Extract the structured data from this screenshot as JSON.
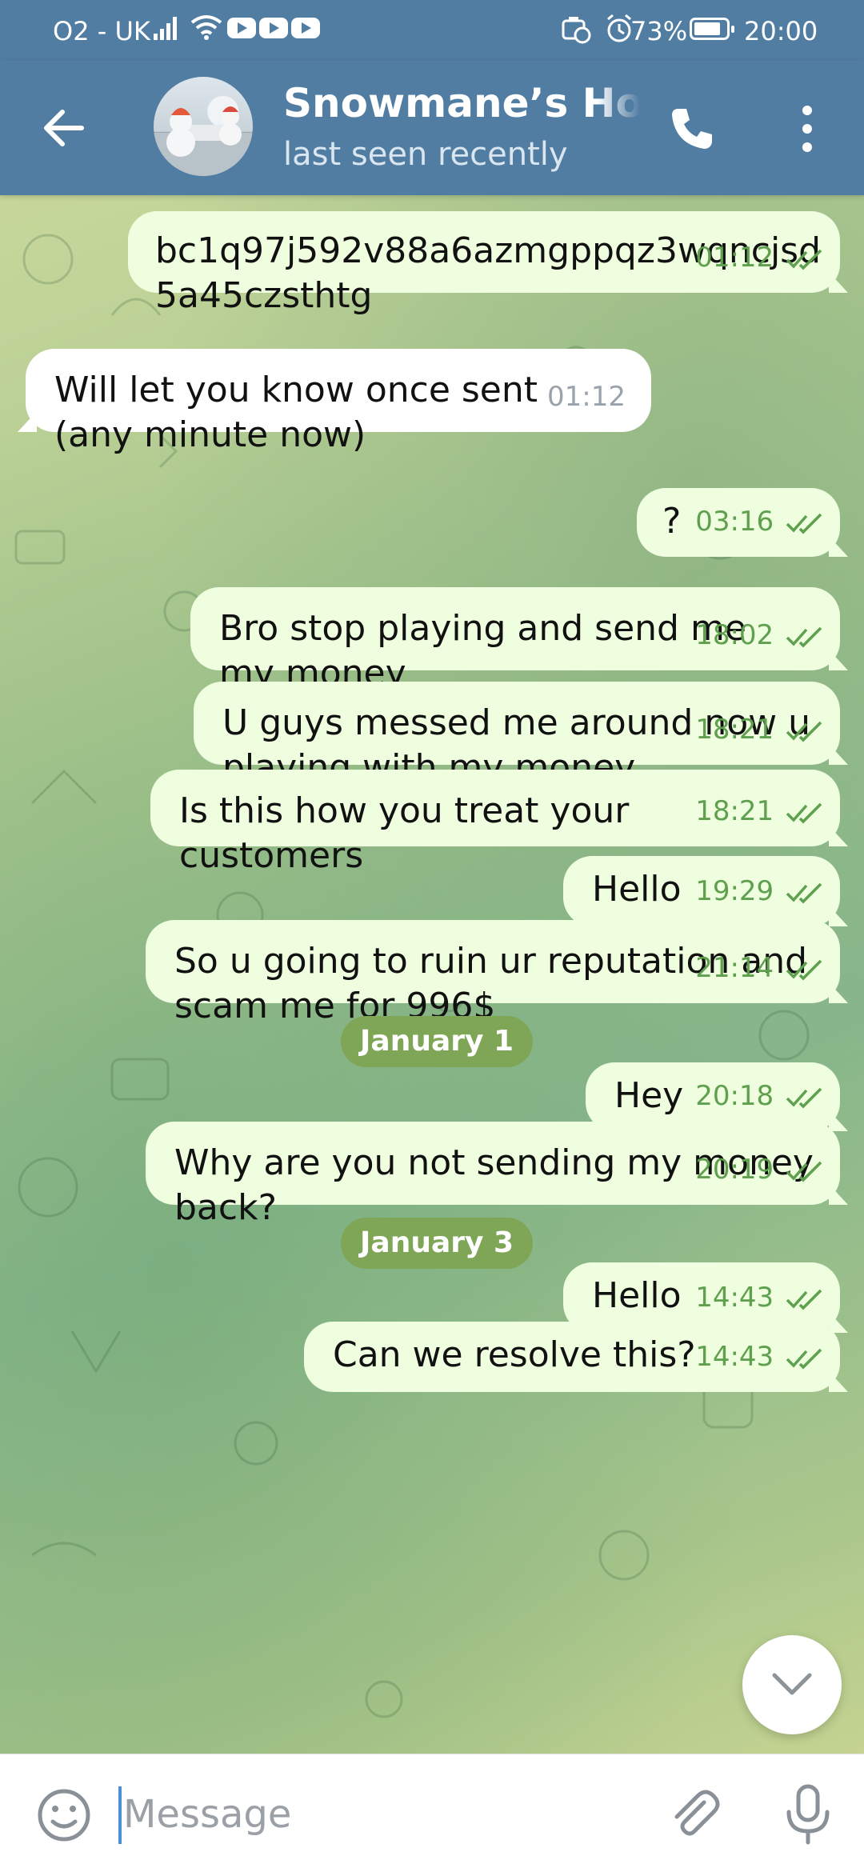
{
  "status_bar": {
    "carrier": "O2 - UK",
    "battery": "73%",
    "time": "20:00",
    "icons": [
      "signal-icon",
      "wifi-icon",
      "youtube-icon",
      "youtube-icon",
      "youtube-icon",
      "battery-saver-icon",
      "alarm-icon",
      "battery-icon"
    ]
  },
  "header": {
    "title": "Snowmane’s Home",
    "subtitle": "last seen recently",
    "back_icon": "arrow-left-icon",
    "call_icon": "phone-icon",
    "menu_icon": "more-vertical-icon"
  },
  "messages": [
    {
      "text": "bc1q97j592v88a6azmgppqz3wqncjsd 5a45czsthtg",
      "time": "01:12",
      "direction": "outgoing",
      "read": true
    },
    {
      "text": "Will let you know once sent (any minute now)",
      "time": "01:12",
      "direction": "incoming"
    },
    {
      "text": "?",
      "time": "03:16",
      "direction": "outgoing",
      "read": true
    },
    {
      "text": "Bro stop playing and send me my money",
      "time": "18:02",
      "direction": "outgoing",
      "read": true
    },
    {
      "text": "U guys messed me around now u playing with my money",
      "time": "18:21",
      "direction": "outgoing",
      "read": true
    },
    {
      "text": "Is this how you treat your customers",
      "time": "18:21",
      "direction": "outgoing",
      "read": true
    },
    {
      "text": "Hello",
      "time": "19:29",
      "direction": "outgoing",
      "read": true
    },
    {
      "text": "So u going to ruin ur reputation and scam me for 996$",
      "time": "21:14",
      "direction": "outgoing",
      "read": true
    },
    {
      "text": "Hey",
      "time": "20:18",
      "direction": "outgoing",
      "read": true
    },
    {
      "text": "Why are you not sending my money back?",
      "time": "20:19",
      "direction": "outgoing",
      "read": true
    },
    {
      "text": "Hello",
      "time": "14:43",
      "direction": "outgoing",
      "read": true
    },
    {
      "text": "Can we resolve this?",
      "time": "14:43",
      "direction": "outgoing",
      "read": true
    }
  ],
  "date_separators": [
    "January 1",
    "January 3"
  ],
  "input": {
    "placeholder": "Message",
    "value": ""
  }
}
